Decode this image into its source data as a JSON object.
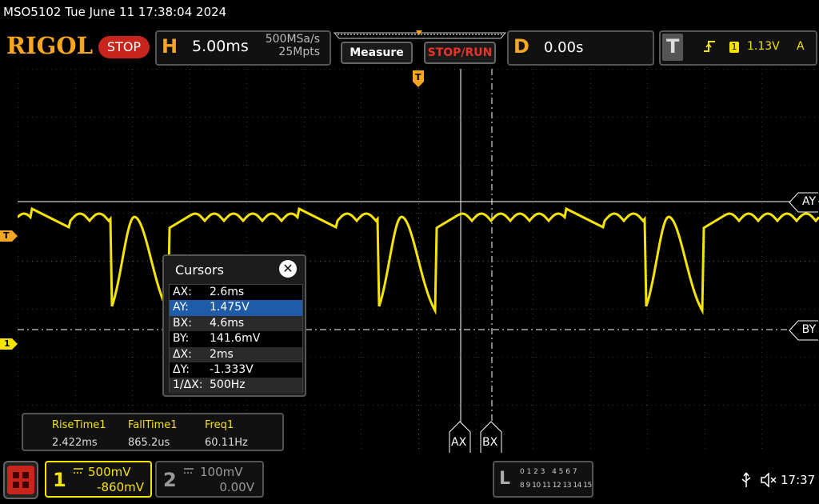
{
  "title": "MSO5102  Tue June 11 17:38:04 2024",
  "brand": "RIGOL",
  "run_state": "STOP",
  "horizontal": {
    "letter": "H",
    "timebase": "5.00ms",
    "sample_rate": "500MSa/s",
    "memory_depth": "25Mpts"
  },
  "buttons": {
    "measure": "Measure",
    "stop_run": "STOP/RUN"
  },
  "delay": {
    "letter": "D",
    "value": "0.00s"
  },
  "trigger": {
    "letter": "T",
    "level": "1.13V",
    "source_label": "A",
    "edge_icon": "rising-edge-icon",
    "channel_marker": "1"
  },
  "markers": {
    "trigger_level": "T",
    "ch1_offset": "1",
    "trigger_position": "T"
  },
  "cursor_tags": {
    "ay": "AY",
    "by": "BY",
    "ax": "AX",
    "bx": "BX"
  },
  "cursors_panel": {
    "title": "Cursors",
    "rows": [
      {
        "key": "AX:",
        "value": "2.6ms"
      },
      {
        "key": "AY:",
        "value": "1.475V"
      },
      {
        "key": "BX:",
        "value": "4.6ms"
      },
      {
        "key": "BY:",
        "value": "141.6mV"
      },
      {
        "key": "ΔX:",
        "value": "2ms"
      },
      {
        "key": "ΔY:",
        "value": "-1.333V"
      },
      {
        "key": "1/ΔX:",
        "value": "500Hz"
      }
    ]
  },
  "measurements": [
    {
      "name": "RiseTime1",
      "value": "2.422ms"
    },
    {
      "name": "FallTime1",
      "value": "865.2us"
    },
    {
      "name": "Freq1",
      "value": "60.11Hz"
    }
  ],
  "channel1": {
    "number": "1",
    "scale": "500mV",
    "offset": "-860mV"
  },
  "channel2": {
    "number": "2",
    "scale": "100mV",
    "offset": "0.00V"
  },
  "logic": {
    "letter": "L",
    "row1": "0 1 2 3   4 5 6 7",
    "row2": "8 9 10 11 12 13 14 15"
  },
  "status": {
    "time": "17:37"
  },
  "colors": {
    "ch1": "#f5e400",
    "accent": "#f5a623",
    "stop": "#c8261d",
    "selected_row": "#1f5ca8"
  }
}
